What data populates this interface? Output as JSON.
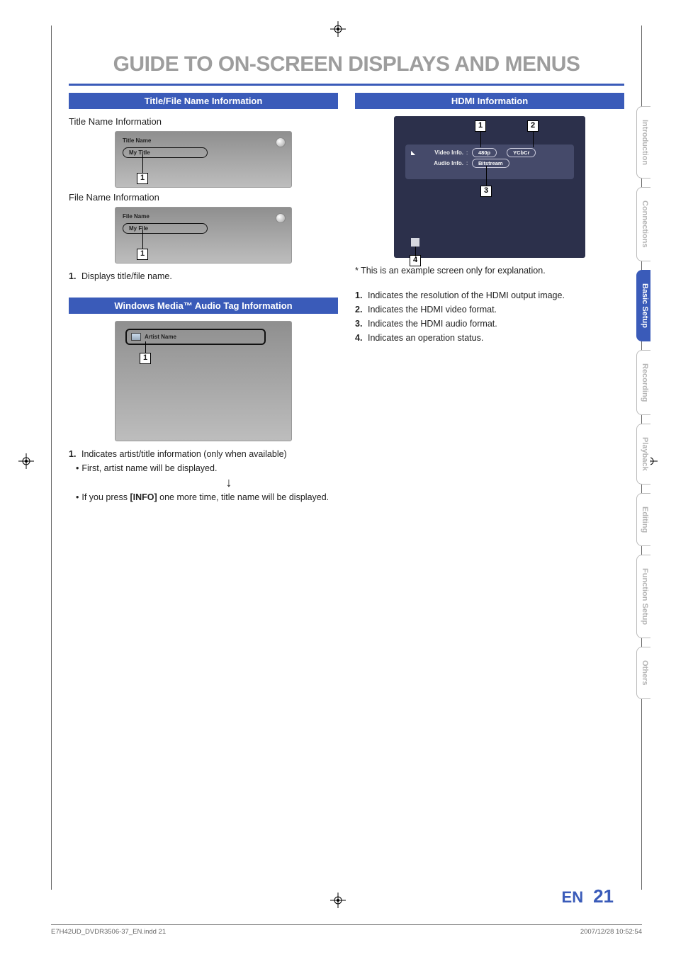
{
  "page_title": "GUIDE TO ON-SCREEN DISPLAYS AND MENUS",
  "left": {
    "section1_head": "Title/File Name Information",
    "title_sub": "Title Name Information",
    "title_label": "Title Name",
    "title_value": "My Title",
    "file_sub": "File Name Information",
    "file_label": "File Name",
    "file_value": "My File",
    "desc1_num": "1.",
    "desc1_text": "Displays title/file name.",
    "section2_head": "Windows Media™ Audio Tag Information",
    "wma_label": "Artist Name",
    "desc2_num": "1.",
    "desc2_text": "Indicates artist/title information (only when available)",
    "bullet1": "First, artist name will be displayed.",
    "bullet2a": "If you press ",
    "bullet2_bold": "[INFO]",
    "bullet2b": " one more time, title name will be displayed.",
    "callout1": "1",
    "callout2": "1",
    "callout3": "1"
  },
  "right": {
    "section_head": "HDMI Information",
    "video_lbl": "Video Info.",
    "audio_lbl": "Audio Info.",
    "val_480p": "480p",
    "val_ycbcr": "YCbCr",
    "val_bitstream": "Bitstream",
    "note": "* This is an example screen only for explanation.",
    "n1": "1",
    "n2": "2",
    "n3": "3",
    "n4": "4",
    "list": {
      "l1n": "1.",
      "l1": "Indicates the resolution of the HDMI output image.",
      "l2n": "2.",
      "l2": "Indicates the HDMI video format.",
      "l3n": "3.",
      "l3": "Indicates the HDMI audio format.",
      "l4n": "4.",
      "l4": "Indicates an operation status."
    }
  },
  "tabs": [
    "Introduction",
    "Connections",
    "Basic Setup",
    "Recording",
    "Playback",
    "Editing",
    "Function Setup",
    "Others"
  ],
  "active_tab_index": 2,
  "footer": {
    "lang": "EN",
    "page": "21"
  },
  "printfoot": {
    "left": "E7H42UD_DVDR3506-37_EN.indd   21",
    "right": "2007/12/28   10:52:54"
  }
}
